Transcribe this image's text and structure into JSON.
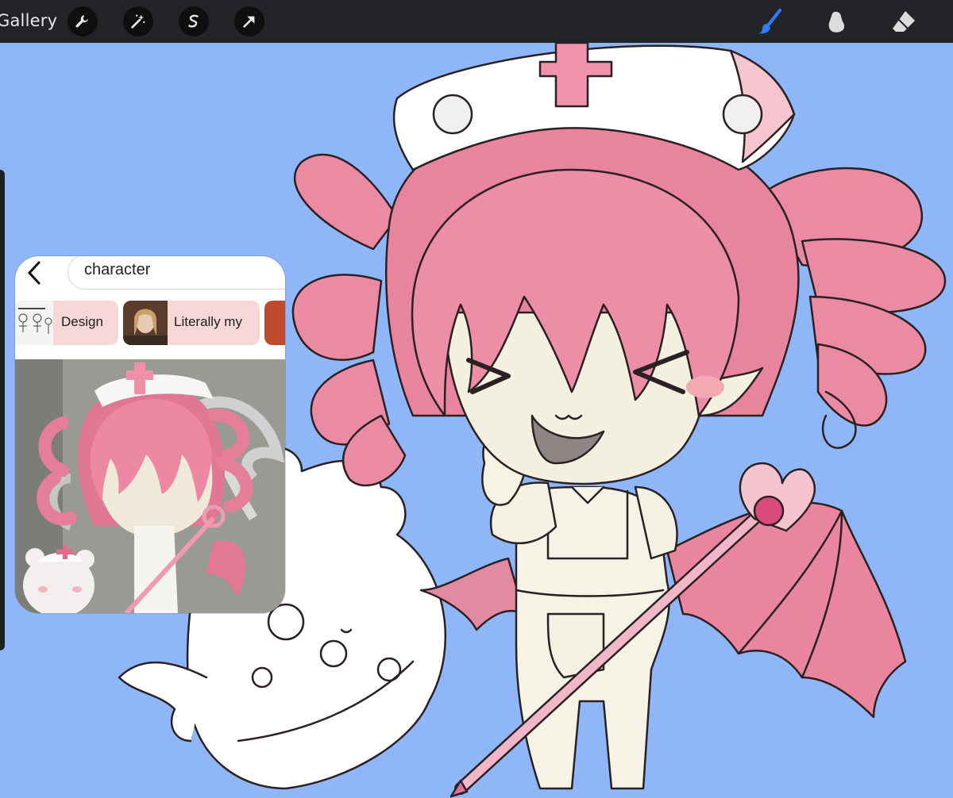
{
  "topbar": {
    "gallery_label": "Gallery",
    "left_tools": [
      {
        "icon": "wrench-icon"
      },
      {
        "icon": "magic-wand-icon"
      },
      {
        "icon": "selection-s-icon"
      },
      {
        "icon": "transform-arrow-icon"
      }
    ],
    "right_tools": [
      {
        "icon": "brush-icon",
        "active": true,
        "color": "#2f7cf6"
      },
      {
        "icon": "smudge-icon"
      },
      {
        "icon": "eraser-icon"
      }
    ]
  },
  "reference_window": {
    "search": {
      "value": "character"
    },
    "chips": [
      {
        "label": "Design"
      },
      {
        "label": "Literally my"
      }
    ]
  },
  "colors": {
    "canvas_background": "#8fb7f7",
    "toolbar": "#232428",
    "chip_background": "#f8d7d7",
    "hair_pink": "#e98ba3",
    "skin": "#f4f0df"
  }
}
